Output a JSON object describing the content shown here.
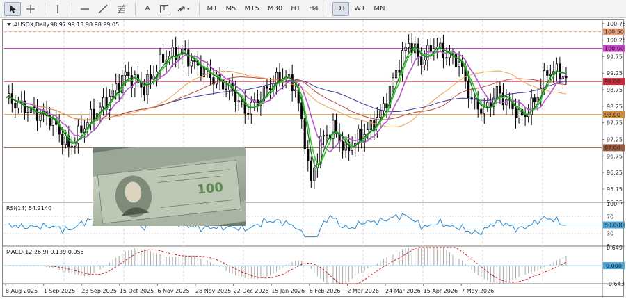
{
  "toolbar": {
    "tools": [
      {
        "name": "cursor-icon"
      },
      {
        "name": "crosshair-icon"
      },
      {
        "name": "vertical-line-icon"
      },
      {
        "name": "horizontal-line-icon"
      },
      {
        "name": "trendline-icon"
      },
      {
        "name": "fibonacci-icon"
      },
      {
        "name": "text-tool-label",
        "label": "A"
      },
      {
        "name": "text-label-tool",
        "label": "T"
      },
      {
        "name": "arrows-icon"
      }
    ],
    "timeframes": [
      "M1",
      "M5",
      "M15",
      "M30",
      "H1",
      "H4",
      "D1",
      "W1",
      "MN"
    ],
    "active_timeframe": "D1"
  },
  "chart_data": {
    "type": "candlestick",
    "symbol_label": "#USDX,Daily",
    "ohlc_label": "98.97 99.13 98.98 99.05",
    "ylim": [
      95.35,
      100.85
    ],
    "y_ticks": [
      "100.75",
      "100.25",
      "99.75",
      "99.25",
      "98.75",
      "98.25",
      "97.75",
      "97.25",
      "96.75",
      "96.25",
      "95.75",
      "95.35"
    ],
    "y_tick_values": [
      100.75,
      100.25,
      99.75,
      99.25,
      98.75,
      98.25,
      97.75,
      97.25,
      96.75,
      96.25,
      95.75,
      95.35
    ],
    "price_levels": [
      {
        "value": 100.5,
        "label": "100.50",
        "color": "#e8a07a",
        "style": "dashed"
      },
      {
        "value": 100.0,
        "label": "100.00",
        "color": "#cc44cc",
        "style": "solid"
      },
      {
        "value": 99.0,
        "label": "99.00",
        "color": "#cc2a3a",
        "style": "solid"
      },
      {
        "value": 98.0,
        "label": "98.00",
        "color": "#d08a3a",
        "style": "solid"
      },
      {
        "value": 97.0,
        "label": "97.00",
        "color": "#9a5a3a",
        "style": "solid"
      }
    ],
    "x_labels": [
      "8 Aug 2025",
      "1 Sep 2025",
      "23 Sep 2025",
      "15 Oct 2025",
      "6 Nov 2025",
      "28 Nov 2025",
      "22 Dec 2025",
      "15 Jan 2026",
      "6 Feb 2026",
      "2 Mar 2026",
      "24 Mar 2026",
      "15 Apr 2026",
      "7 May 2026"
    ],
    "close_anchors": [
      {
        "i": 0,
        "v": 98.5
      },
      {
        "i": 8,
        "v": 98.1
      },
      {
        "i": 14,
        "v": 97.9
      },
      {
        "i": 20,
        "v": 97.0
      },
      {
        "i": 26,
        "v": 97.8
      },
      {
        "i": 32,
        "v": 98.4
      },
      {
        "i": 38,
        "v": 99.2
      },
      {
        "i": 44,
        "v": 98.8
      },
      {
        "i": 50,
        "v": 99.7
      },
      {
        "i": 56,
        "v": 99.9
      },
      {
        "i": 60,
        "v": 99.5
      },
      {
        "i": 66,
        "v": 99.1
      },
      {
        "i": 72,
        "v": 98.7
      },
      {
        "i": 76,
        "v": 98.1
      },
      {
        "i": 80,
        "v": 98.4
      },
      {
        "i": 84,
        "v": 98.9
      },
      {
        "i": 88,
        "v": 99.2
      },
      {
        "i": 92,
        "v": 98.8
      },
      {
        "i": 95,
        "v": 97.2
      },
      {
        "i": 97,
        "v": 95.9
      },
      {
        "i": 100,
        "v": 97.2
      },
      {
        "i": 104,
        "v": 97.6
      },
      {
        "i": 108,
        "v": 96.9
      },
      {
        "i": 112,
        "v": 97.3
      },
      {
        "i": 116,
        "v": 97.6
      },
      {
        "i": 120,
        "v": 98.2
      },
      {
        "i": 124,
        "v": 99.3
      },
      {
        "i": 128,
        "v": 100.2
      },
      {
        "i": 132,
        "v": 99.6
      },
      {
        "i": 136,
        "v": 100.1
      },
      {
        "i": 140,
        "v": 99.8
      },
      {
        "i": 144,
        "v": 99.6
      },
      {
        "i": 148,
        "v": 98.4
      },
      {
        "i": 152,
        "v": 98.1
      },
      {
        "i": 156,
        "v": 98.7
      },
      {
        "i": 160,
        "v": 98.3
      },
      {
        "i": 164,
        "v": 97.9
      },
      {
        "i": 168,
        "v": 98.4
      },
      {
        "i": 172,
        "v": 99.3
      },
      {
        "i": 176,
        "v": 99.3
      },
      {
        "i": 178,
        "v": 99.05
      }
    ],
    "vertical_grid_count": 9,
    "rsi": {
      "label": "RSI(14) 54.2140",
      "ylim": [
        0,
        100
      ],
      "y_ticks": [
        "100",
        "70",
        "50.0000",
        "30",
        "0"
      ],
      "y_tick_values": [
        100,
        70,
        50,
        30,
        0
      ],
      "level": 50,
      "color": "#2a86c8"
    },
    "macd": {
      "label": "MACD(12,26,9) 0.139 0.055",
      "ylim": [
        -0.643,
        0.649
      ],
      "y_ticks": [
        "0.649",
        "0.000",
        "-0.643"
      ],
      "y_tick_values": [
        0.649,
        0.0,
        -0.643
      ],
      "signal_color": "#cc2222",
      "histogram_color": "#a8a8a8"
    },
    "colors": {
      "candle": "#000000",
      "ema_fast": "#1f7a1f",
      "ema_fast2": "#36c236",
      "ema_slow": "#b259c8",
      "ma_orange": "#f0a04a",
      "ma_red": "#b84a3a",
      "ma_blue": "#3a3aa0",
      "grid": "#d0d0d0",
      "axis_line": "#777777"
    }
  },
  "overlay_image": {
    "name": "hundred-dollar-bills-photo",
    "banknote_text": "100"
  }
}
